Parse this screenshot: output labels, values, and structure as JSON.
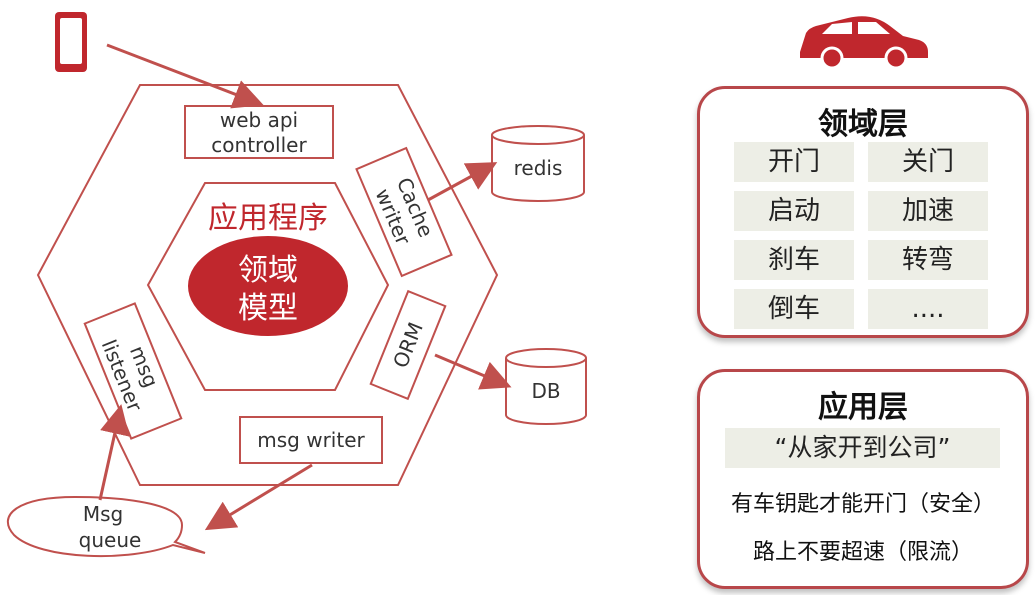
{
  "architecture": {
    "core_label": [
      "领域",
      "模型"
    ],
    "app_layer_label": "应用程序",
    "adapters": {
      "web_api": [
        "web api",
        "controller"
      ],
      "cache_writer": [
        "Cache",
        "writer"
      ],
      "orm": "ORM",
      "msg_writer": "msg writer",
      "msg_listener": [
        "msg",
        "listener"
      ]
    },
    "externals": {
      "redis": "redis",
      "db": "DB",
      "msg_queue": [
        "Msg",
        "queue"
      ]
    },
    "icons": [
      "mobile-phone-icon",
      "car-icon"
    ],
    "colors": {
      "accent": "#c0272d",
      "line": "#c0504d",
      "panel_border": "#b8474a",
      "cell_bg": "#edeee6"
    }
  },
  "domain_layer": {
    "title": "领域层",
    "items": [
      "开门",
      "关门",
      "启动",
      "加速",
      "刹车",
      "转弯",
      "倒车",
      "...."
    ]
  },
  "application_layer": {
    "title": "应用层",
    "scenario": "“从家开到公司”",
    "rules": [
      "有车钥匙才能开门（安全）",
      "路上不要超速（限流）"
    ]
  }
}
